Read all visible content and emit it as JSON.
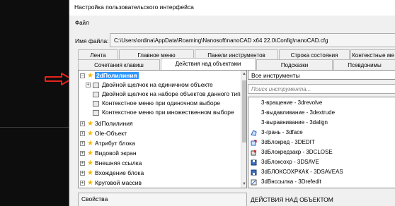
{
  "window": {
    "title": "Настройка пользовательского интерфейса",
    "menu_file": "Файл",
    "file_label": "Имя файла:",
    "file_path": "C:\\Users\\ordina\\AppData\\Roaming\\Nanosoft\\nanoCAD x64 22.0\\Config\\nanoCAD.cfg"
  },
  "tabs_row1": [
    "Лента",
    "Главное меню",
    "Панели инструментов",
    "Строка состояния",
    "Контекстные ме"
  ],
  "tabs_row2": [
    "Сочетания клавиш",
    "Действия над объектами",
    "Подсказки",
    "Псевдонимы"
  ],
  "active_tab": "Действия над объектами",
  "tree": {
    "selected": "2dПолилиния",
    "children": [
      "Двойной щелчок на единичном объекте",
      "Двойной щелчок на наборе объектов данного типа",
      "Контекстное меню при одиночном выборе",
      "Контекстное меню при множественном выборе"
    ],
    "items": [
      "3dПолилиния",
      "Ole-Объект",
      "Атрибут блока",
      "Видовой экран",
      "Внешняя ссылка",
      "Вхождение блока",
      "Круговой массив"
    ]
  },
  "properties_label": "Свойства",
  "commands": {
    "header": "Все инструменты",
    "search_placeholder": "Поиск инструмента...",
    "items": [
      "3-вращение - 3drevolve",
      "3-выдавливание - 3dextrude",
      "3-выравнивание - 3dalign",
      "3-грань - 3dface",
      "3dБлокред - 3DEDIT",
      "3dБлокредзакр - 3DCLOSE",
      "3dБлоксохр - 3DSAVE",
      "3dБЛОКСОХРКАК - 3DSAVEAS",
      "3dВнссылка - 3Drefedit"
    ]
  },
  "action_label": "ДЕЙСТВИЯ НАД ОБЪЕКТОМ",
  "colors": {
    "selection": "#3399ff",
    "star": "#f2b705",
    "arrow": "#e8221b"
  }
}
